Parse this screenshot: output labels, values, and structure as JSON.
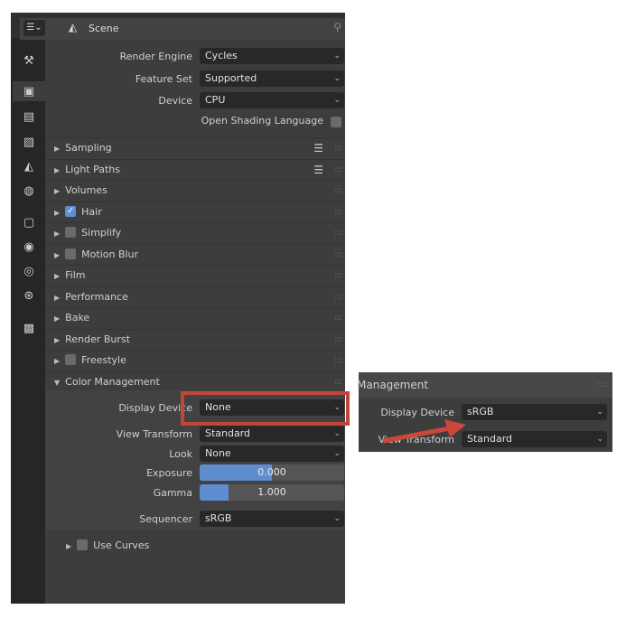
{
  "header": {
    "title": "Scene",
    "editor_icon": "properties-editor-icon",
    "scene_icon": "scene-icon",
    "pin_icon": "pin-icon"
  },
  "tabs": [
    {
      "icon": "tool-icon"
    },
    {
      "icon": "render-icon",
      "active": true
    },
    {
      "icon": "output-icon"
    },
    {
      "icon": "view-layer-icon"
    },
    {
      "icon": "scene-icon"
    },
    {
      "icon": "world-icon"
    },
    {
      "icon": "object-icon"
    },
    {
      "icon": "modifier-icon"
    },
    {
      "icon": "physics-icon"
    },
    {
      "icon": "constraint-icon"
    },
    {
      "icon": "texture-icon"
    }
  ],
  "render": {
    "render_engine": {
      "label": "Render Engine",
      "value": "Cycles"
    },
    "feature_set": {
      "label": "Feature Set",
      "value": "Supported"
    },
    "device": {
      "label": "Device",
      "value": "CPU"
    },
    "osl": {
      "label": "Open Shading Language",
      "checked": false
    }
  },
  "sections": [
    {
      "label": "Sampling",
      "list_icon": true
    },
    {
      "label": "Light Paths",
      "list_icon": true
    },
    {
      "label": "Volumes"
    },
    {
      "label": "Hair",
      "checkbox": true,
      "checked": true
    },
    {
      "label": "Simplify",
      "checkbox": true,
      "checked": false
    },
    {
      "label": "Motion Blur",
      "checkbox": true,
      "checked": false
    },
    {
      "label": "Film"
    },
    {
      "label": "Performance"
    },
    {
      "label": "Bake"
    },
    {
      "label": "Render Burst"
    },
    {
      "label": "Freestyle",
      "checkbox": true,
      "checked": false
    },
    {
      "label": "Color Management",
      "expanded": true
    }
  ],
  "color_management": {
    "display_device": {
      "label": "Display Device",
      "value": "None"
    },
    "view_transform": {
      "label": "View Transform",
      "value": "Standard"
    },
    "look": {
      "label": "Look",
      "value": "None"
    },
    "exposure": {
      "label": "Exposure",
      "value": "0.000",
      "fill_percent": 50
    },
    "gamma": {
      "label": "Gamma",
      "value": "1.000",
      "fill_percent": 20
    },
    "sequencer": {
      "label": "Sequencer",
      "value": "sRGB"
    },
    "use_curves": {
      "label": "Use Curves",
      "checked": false
    }
  },
  "inset": {
    "title": "Management",
    "display_device": {
      "label": "Display Device",
      "value": "sRGB"
    },
    "view_transform": {
      "label": "View Transform",
      "value": "Standard"
    }
  },
  "annotation_colors": {
    "highlight": "#c0463a",
    "arrow": "#c9473b"
  }
}
